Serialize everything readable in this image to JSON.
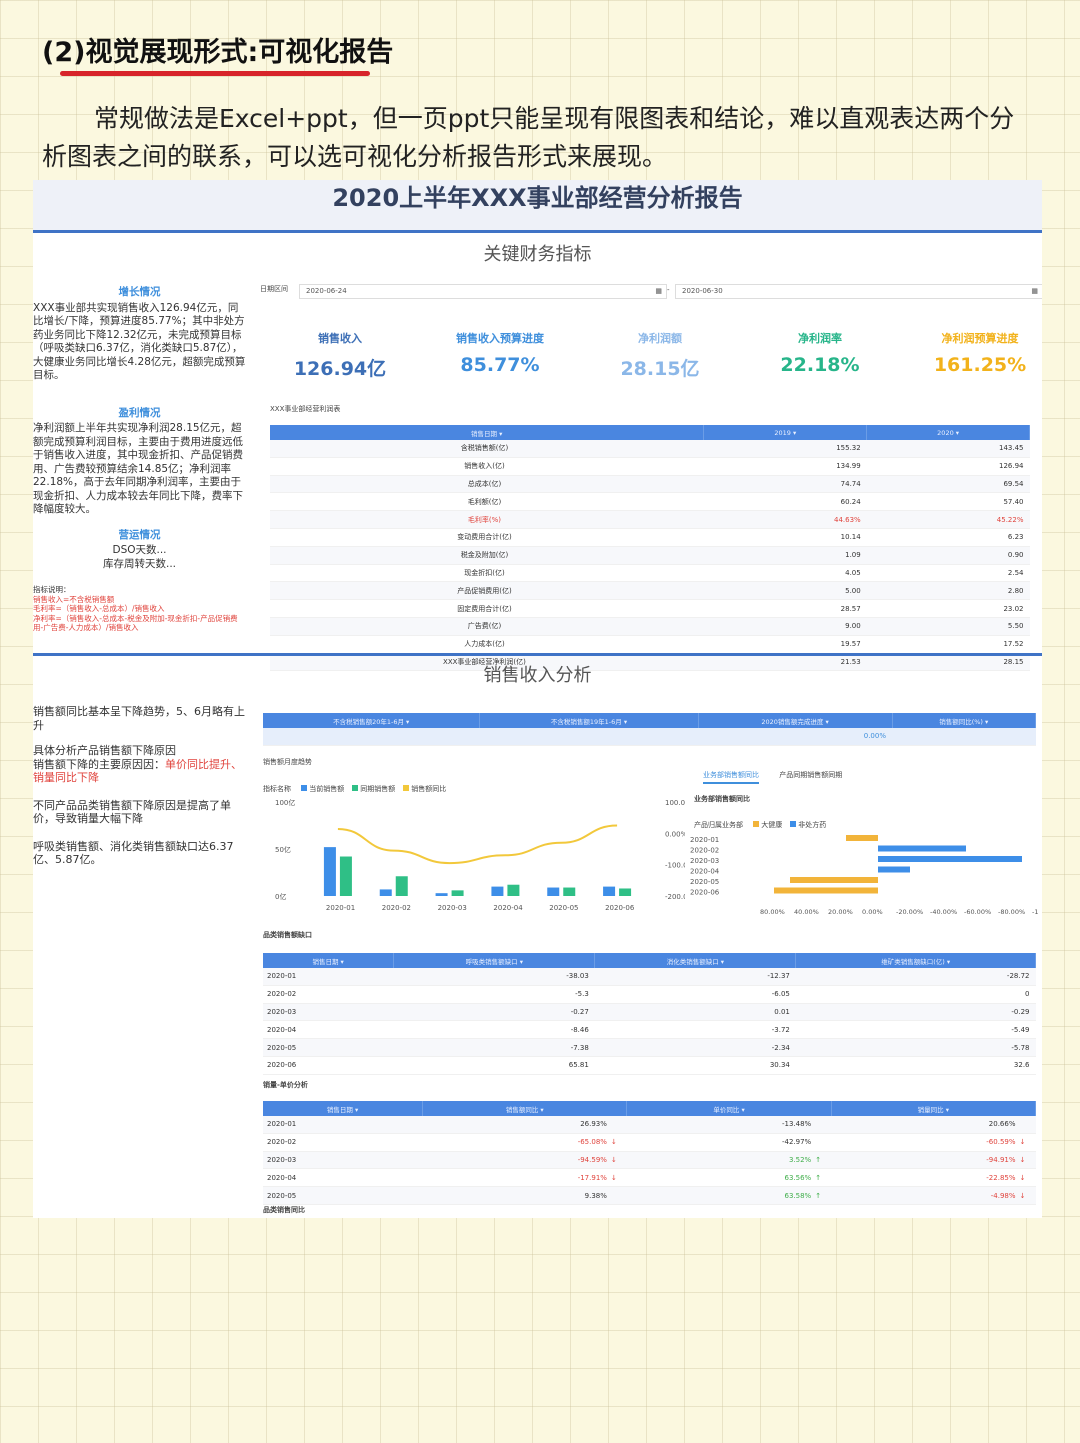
{
  "heading": "(2)视觉展现形式:可视化报告",
  "intro": "常规做法是Excel+ppt，但一页ppt只能呈现有限图表和结论，难以直观表达两个分析图表之间的联系，可以选可视化分析报告形式来展现。",
  "report": {
    "title": "2020上半年XXX事业部经营分析报告",
    "section1": "关键财务指标",
    "section2": "销售收入分析",
    "left1": {
      "growth_title": "增长情况",
      "growth_text": "XXX事业部共实现销售收入126.94亿元，同比增长/下降，预算进度85.77%；其中非处方药业务同比下降12.32亿元，未完成预算目标（呼吸类缺口6.37亿，消化类缺口5.87亿），大健康业务同比增长4.28亿元，超额完成预算目标。",
      "profit_title": "盈利情况",
      "profit_text": "净利润额上半年共实现净利润28.15亿元，超额完成预算利润目标，主要由于费用进度远低于销售收入进度，其中现金折扣、产品促销费用、广告费较预算结余14.85亿；净利润率22.18%，高于去年同期净利润率，主要由于现金折扣、人力成本较去年同比下降，费率下降幅度较大。",
      "ops_title": "营运情况",
      "ops_line1": "DSO天数...",
      "ops_line2": "库存周转天数...",
      "notes_title": "指标说明：",
      "note1": "销售收入=不含税销售额",
      "note2": "毛利率=（销售收入-总成本）/销售收入",
      "note3": "净利率=（销售收入-总成本-税金及附加-现金折扣-产品促销费用-广告费-人力成本）/销售收入"
    },
    "date_label": "日期区间",
    "date_start": "2020-06-24",
    "date_end": "2020-06-30",
    "kpis": [
      {
        "label": "销售收入",
        "value": "126.94亿",
        "color": "#3d6fb6"
      },
      {
        "label": "销售收入预算进度",
        "value": "85.77%",
        "color": "#3f8fdc"
      },
      {
        "label": "净利润额",
        "value": "28.15亿",
        "color": "#8bb7e8"
      },
      {
        "label": "净利润率",
        "value": "22.18%",
        "color": "#27b58a"
      },
      {
        "label": "净利润预算进度",
        "value": "161.25%",
        "color": "#f2b21b"
      }
    ],
    "pnl_title": "XXX事业部经营利润表",
    "pnl_headers": [
      "销售日期",
      "2019",
      "2020"
    ],
    "pnl_rows": [
      [
        "含税销售额(亿)",
        "155.32",
        "143.45"
      ],
      [
        "销售收入(亿)",
        "134.99",
        "126.94"
      ],
      [
        "总成本(亿)",
        "74.74",
        "69.54"
      ],
      [
        "毛利额(亿)",
        "60.24",
        "57.40"
      ],
      [
        "毛利率(%)",
        "44.63%",
        "45.22%"
      ],
      [
        "变动费用合计(亿)",
        "10.14",
        "6.23"
      ],
      [
        "税金及附加(亿)",
        "1.09",
        "0.90"
      ],
      [
        "现金折扣(亿)",
        "4.05",
        "2.54"
      ],
      [
        "产品促销费用(亿)",
        "5.00",
        "2.80"
      ],
      [
        "固定费用合计(亿)",
        "28.57",
        "23.02"
      ],
      [
        "广告费(亿)",
        "9.00",
        "5.50"
      ],
      [
        "人力成本(亿)",
        "19.57",
        "17.52"
      ],
      [
        "XXX事业部经营净利润(亿)",
        "21.53",
        "28.15"
      ]
    ],
    "left2": {
      "p1": "销售额同比基本呈下降趋势，5、6月略有上升",
      "p2a": "具体分析产品销售额下降原因",
      "p2b": "销售额下降的主要原因因：",
      "p2c": "单价同比提升、销量同比下降",
      "p3": "不同产品品类销售额下降原因是提高了单价，导致销量大幅下降",
      "p4": "呼吸类销售额、消化类销售额缺口达6.37亿、5.87亿。"
    },
    "summary_headers": [
      "不含税销售额20年1-6月",
      "不含税销售额19年1-6月",
      "2020销售额完成进度",
      "销售额同比(%)"
    ],
    "summary_value": "0.00%",
    "trend_title": "销售额月度趋势",
    "trend_legend_title": "指标名称",
    "trend_legend": [
      "当前销售额",
      "同期销售额",
      "销售额同比"
    ],
    "biz_tabs": [
      "业务部销售额同比",
      "产品同期销售额同期"
    ],
    "biz_title": "业务部销售额同比",
    "biz_legend_title": "产品归属业务部",
    "biz_legend": [
      "大健康",
      "非处方药"
    ],
    "gap_title": "品类销售额缺口",
    "gap_headers": [
      "销售日期",
      "呼吸类销售额缺口",
      "消化类销售额缺口",
      "维矿类销售额缺口(亿)"
    ],
    "gap_rows": [
      [
        "2020-01",
        "-38.03",
        "-12.37",
        "-28.72"
      ],
      [
        "2020-02",
        "-5.3",
        "-6.05",
        "0"
      ],
      [
        "2020-03",
        "-0.27",
        "0.01",
        "-0.29"
      ],
      [
        "2020-04",
        "-8.46",
        "-3.72",
        "-5.49"
      ],
      [
        "2020-05",
        "-7.38",
        "-2.34",
        "-5.78"
      ],
      [
        "2020-06",
        "65.81",
        "30.34",
        "32.6"
      ]
    ],
    "vol_title": "销量-单价分析",
    "vol_headers": [
      "销售日期",
      "销售额同比",
      "单价同比",
      "销量同比"
    ],
    "vol_rows": [
      [
        "2020-01",
        "26.93%",
        "",
        "-13.48%",
        "",
        "20.66%",
        ""
      ],
      [
        "2020-02",
        "-65.08%",
        "down",
        "-42.97%",
        "",
        "-60.59%",
        "down"
      ],
      [
        "2020-03",
        "-94.59%",
        "down",
        "3.52%",
        "up",
        "-94.91%",
        "down"
      ],
      [
        "2020-04",
        "-17.91%",
        "down",
        "63.56%",
        "up",
        "-22.85%",
        "down"
      ],
      [
        "2020-05",
        "9.38%",
        "",
        "63.58%",
        "up",
        "-4.98%",
        "down"
      ]
    ],
    "category_title": "品类销售同比"
  },
  "chart_data": [
    {
      "type": "bar",
      "title": "销售额月度趋势",
      "categories": [
        "2020-01",
        "2020-02",
        "2020-03",
        "2020-04",
        "2020-05",
        "2020-06"
      ],
      "series": [
        {
          "name": "当前销售额",
          "values": [
            52,
            7,
            3,
            10,
            9,
            10
          ]
        },
        {
          "name": "同期销售额",
          "values": [
            42,
            21,
            6,
            12,
            9,
            8
          ]
        },
        {
          "name": "销售额同比",
          "values": [
            14,
            -55,
            -95,
            -70,
            -30,
            25
          ]
        }
      ],
      "ylim": [
        0,
        100
      ],
      "y_ticks": [
        "100亿",
        "50亿",
        "0亿"
      ],
      "y2_ticks": [
        "100.00%",
        "0.00%",
        "-100.00%",
        "-200.00%"
      ],
      "colors": {
        "current": "#3d8ee8",
        "previous": "#2fbf86",
        "yoy": "#f2c83b"
      }
    },
    {
      "type": "bar",
      "title": "业务部销售额同比",
      "orientation": "horizontal",
      "categories": [
        "2020-01",
        "2020-02",
        "2020-03",
        "2020-04",
        "2020-05",
        "2020-06"
      ],
      "series": [
        {
          "name": "大健康",
          "values": [
            20,
            0,
            0,
            0,
            55,
            65
          ]
        },
        {
          "name": "非处方药",
          "values": [
            0,
            -55,
            -90,
            -20,
            0,
            0
          ]
        }
      ],
      "x_ticks": [
        "80.00%",
        "40.00%",
        "20.00%",
        "0.00%",
        "-20.00%",
        "-40.00%",
        "-60.00%",
        "-80.00%",
        "-120.00%"
      ],
      "colors": {
        "health": "#f2b43a",
        "otc": "#3d8ee8"
      }
    }
  ]
}
